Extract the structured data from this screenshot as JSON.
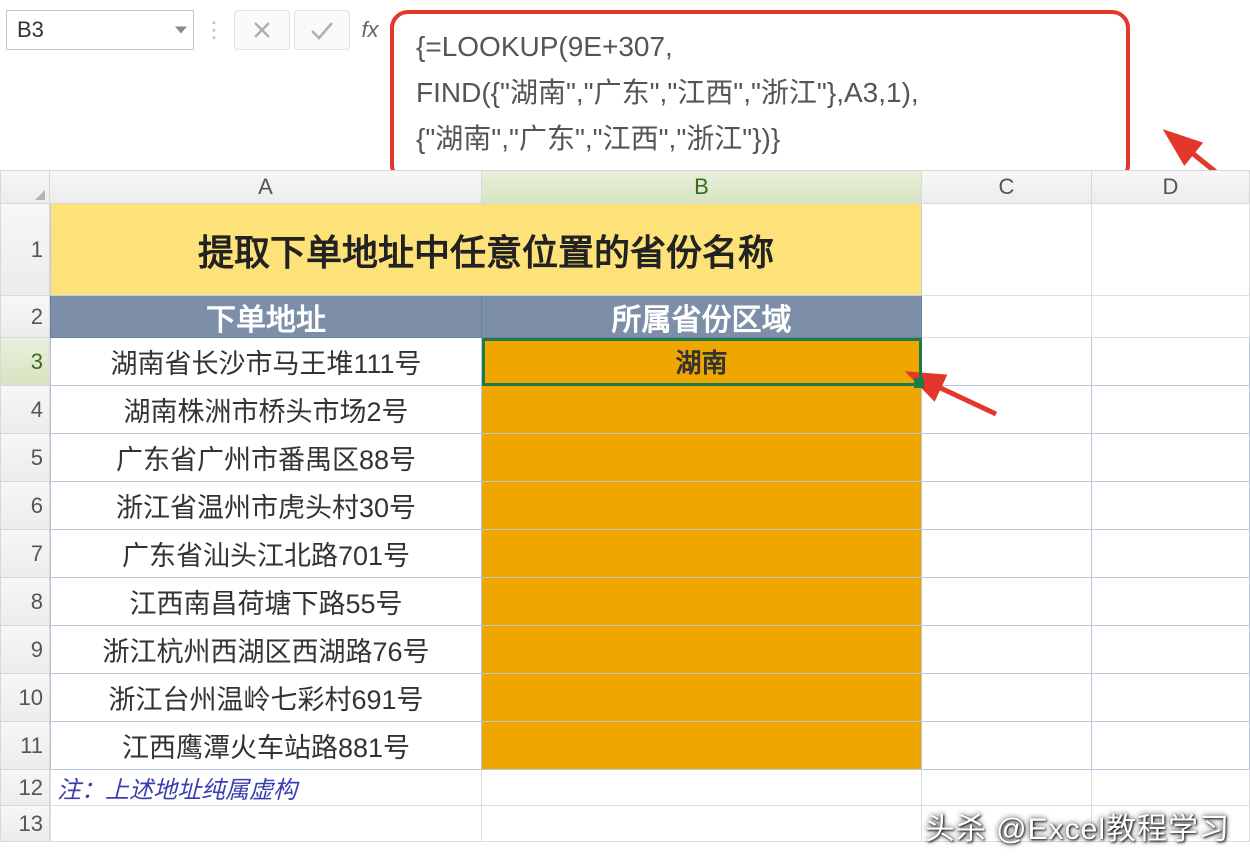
{
  "nameBox": {
    "value": "B3"
  },
  "formulaBar": {
    "fx_label": "fx",
    "cancel_icon": "cancel-icon",
    "confirm_icon": "confirm-icon",
    "formula_lines": [
      "{=LOOKUP(9E+307,",
      "FIND({\"湖南\",\"广东\",\"江西\",\"浙江\"},A3,1),",
      "{\"湖南\",\"广东\",\"江西\",\"浙江\"})}"
    ]
  },
  "columns": {
    "A": "A",
    "B": "B",
    "C": "C",
    "D": "D"
  },
  "row_numbers": [
    "1",
    "2",
    "3",
    "4",
    "5",
    "6",
    "7",
    "8",
    "9",
    "10",
    "11",
    "12",
    "13"
  ],
  "title": "提取下单地址中任意位置的省份名称",
  "headers": {
    "A": "下单地址",
    "B": "所属省份区域"
  },
  "data": [
    {
      "addr": "湖南省长沙市马王堆111号",
      "prov": "湖南"
    },
    {
      "addr": "湖南株洲市桥头市场2号",
      "prov": ""
    },
    {
      "addr": "广东省广州市番禺区88号",
      "prov": ""
    },
    {
      "addr": "浙江省温州市虎头村30号",
      "prov": ""
    },
    {
      "addr": "广东省汕头江北路701号",
      "prov": ""
    },
    {
      "addr": "江西南昌荷塘下路55号",
      "prov": ""
    },
    {
      "addr": "浙江杭州西湖区西湖路76号",
      "prov": ""
    },
    {
      "addr": "浙江台州温岭七彩村691号",
      "prov": ""
    },
    {
      "addr": "江西鹰潭火车站路881号",
      "prov": ""
    }
  ],
  "note": "注：上述地址纯属虚构",
  "watermark": "头杀 @Excel教程学习",
  "selection": {
    "cell": "B3"
  },
  "colors": {
    "highlight_border": "#e3372b",
    "header_fill": "#7d8fa8",
    "title_fill": "#fde27a",
    "prov_fill": "#efa700",
    "selection_green": "#1f7a4a"
  }
}
